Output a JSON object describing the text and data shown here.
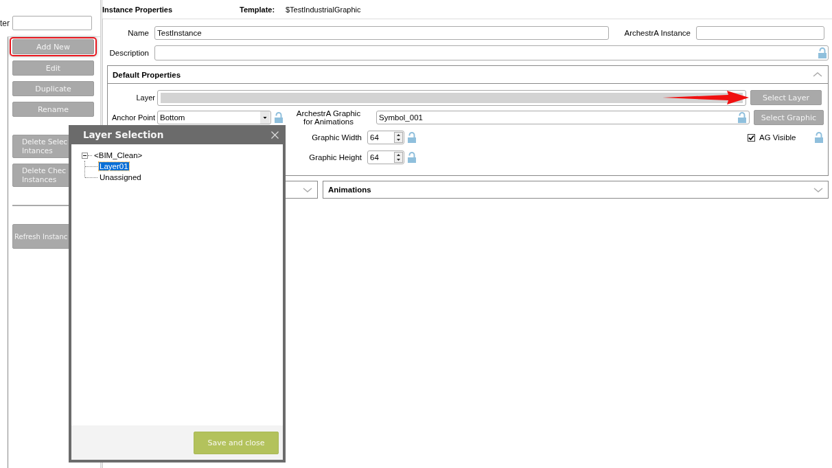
{
  "left_panel": {
    "filter_label": "ter",
    "groups": [
      {
        "divider_above": false,
        "buttons": [
          {
            "label": "Add New",
            "highlighted": true
          },
          {
            "label": "Edit",
            "highlighted": false
          },
          {
            "label": "Duplicate",
            "highlighted": false
          },
          {
            "label": "Rename",
            "highlighted": false
          }
        ]
      },
      {
        "divider_above": false,
        "buttons": [
          {
            "label": "Delete Selec\nIntances",
            "highlighted": false
          },
          {
            "label": "Delete Chec\nInstances",
            "highlighted": false
          }
        ]
      },
      {
        "divider_above": true,
        "buttons": [
          {
            "label": "Refresh Instanc",
            "highlighted": false
          }
        ]
      }
    ]
  },
  "header": {
    "title": "Instance Properties",
    "template_label": "Template:",
    "template_value": "$TestIndustrialGraphic"
  },
  "name": {
    "label": "Name",
    "value": "TestInstance"
  },
  "archestra_instance": {
    "label": "ArchestrA Instance"
  },
  "description": {
    "label": "Description",
    "locked": false
  },
  "default_properties": {
    "title": "Default Properties",
    "expanded": true,
    "layer": {
      "label": "Layer",
      "button": "Select Layer"
    },
    "anchor_point": {
      "label": "Anchor Point",
      "value": "Bottom",
      "locked": false
    },
    "graphic": {
      "label": "ArchestrA Graphic\nfor Animations",
      "value": "Symbol_001",
      "locked": false,
      "button": "Select Graphic"
    },
    "width": {
      "label": "Graphic Width",
      "value": "64",
      "locked": false
    },
    "height": {
      "label": "Graphic Height",
      "value": "64",
      "locked": false
    },
    "ag_visible": {
      "label": "AG Visible",
      "checked": true,
      "locked": false
    }
  },
  "collapsed_panels": [
    {
      "expanded": false
    },
    {
      "title": "Animations",
      "expanded": false
    }
  ],
  "dialog": {
    "title": "Layer Selection",
    "button": "Save and close",
    "tree": [
      {
        "label": "<BIM_Clean>",
        "expanded": true,
        "selected": false,
        "children": [
          {
            "label": "Layer01",
            "selected": true
          },
          {
            "label": "Unassigned",
            "selected": false
          }
        ]
      }
    ]
  }
}
